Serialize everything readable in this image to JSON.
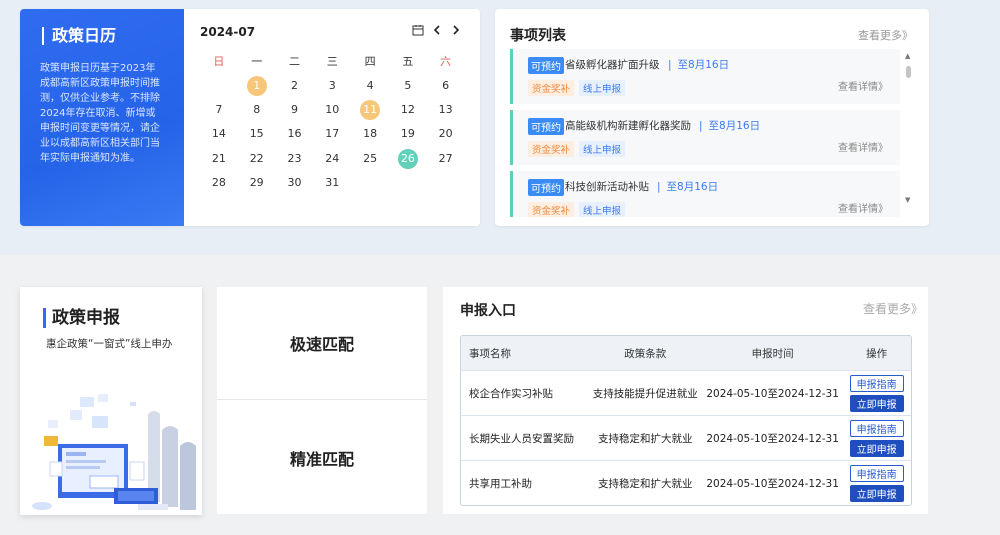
{
  "calendar_section": {
    "title": "政策日历",
    "description": "政策申报日历基于2023年成都高新区政策申报时间推测，仅供企业参考。不排除2024年存在取消、新增或申报时间变更等情况，请企业以成都高新区相关部门当年实际申报通知为准。",
    "month": "2024-07",
    "weekdays": [
      "日",
      "一",
      "二",
      "三",
      "四",
      "五",
      "六"
    ],
    "weeks": [
      [
        "",
        "1",
        "2",
        "3",
        "4",
        "5",
        "6"
      ],
      [
        "7",
        "8",
        "9",
        "10",
        "11",
        "12",
        "13"
      ],
      [
        "14",
        "15",
        "16",
        "17",
        "18",
        "19",
        "20"
      ],
      [
        "21",
        "22",
        "23",
        "24",
        "25",
        "26",
        "27"
      ],
      [
        "28",
        "29",
        "30",
        "31",
        "",
        "",
        ""
      ]
    ],
    "highlight_orange": [
      "1",
      "11"
    ],
    "highlight_green": [
      "26"
    ],
    "colors": {
      "orange": "#f6c779",
      "green": "#63d0b9",
      "weekend": "#e85b5b"
    }
  },
  "items_section": {
    "title": "事项列表",
    "more": "查看更多》",
    "items": [
      {
        "badge": "可预约",
        "name": "省级孵化器扩面升级",
        "deadline": "至8月16日",
        "tag1": "资金奖补",
        "tag2": "线上申报",
        "detail": "查看详情》"
      },
      {
        "badge": "可预约",
        "name": "高能级机构新建孵化器奖励",
        "deadline": "至8月16日",
        "tag1": "资金奖补",
        "tag2": "线上申报",
        "detail": "查看详情》"
      },
      {
        "badge": "可预约",
        "name": "科技创新活动补贴",
        "deadline": "至8月16日",
        "tag1": "资金奖补",
        "tag2": "线上申报",
        "detail": "查看详情》"
      }
    ]
  },
  "policy_section": {
    "title": "政策申报",
    "subtitle": "惠企政策“一窗式”线上申办"
  },
  "match_section": {
    "fast": "极速匹配",
    "precise": "精准匹配"
  },
  "entry_section": {
    "title": "申报入口",
    "more": "查看更多》",
    "columns": [
      "事项名称",
      "政策条款",
      "申报时间",
      "操作"
    ],
    "rows": [
      {
        "name": "校企合作实习补贴",
        "clause": "支持技能提升促进就业",
        "time": "2024-05-10至2024-12-31",
        "guide": "申报指南",
        "apply": "立即申报"
      },
      {
        "name": "长期失业人员安置奖励",
        "clause": "支持稳定和扩大就业",
        "time": "2024-05-10至2024-12-31",
        "guide": "申报指南",
        "apply": "立即申报"
      },
      {
        "name": "共享用工补助",
        "clause": "支持稳定和扩大就业",
        "time": "2024-05-10至2024-12-31",
        "guide": "申报指南",
        "apply": "立即申报"
      }
    ]
  }
}
